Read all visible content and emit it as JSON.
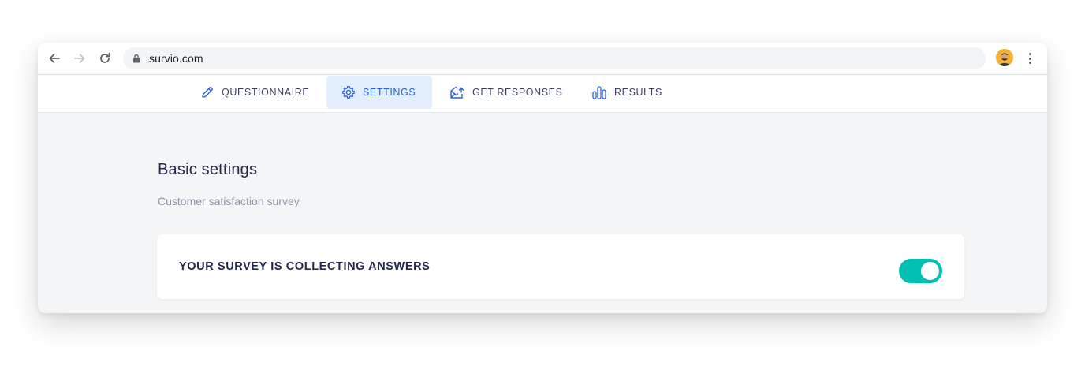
{
  "browser": {
    "url": "survio.com",
    "icons": {
      "back": "arrow-left-icon",
      "forward": "arrow-right-icon",
      "reload": "reload-icon",
      "lock": "lock-icon",
      "menu": "kebab-menu-icon"
    }
  },
  "tabs": [
    {
      "label": "QUESTIONNAIRE",
      "icon": "pencil-icon",
      "active": false
    },
    {
      "label": "SETTINGS",
      "icon": "gear-icon",
      "active": true
    },
    {
      "label": "GET RESPONSES",
      "icon": "envelope-share-icon",
      "active": false
    },
    {
      "label": "RESULTS",
      "icon": "bar-chart-icon",
      "active": false
    }
  ],
  "page": {
    "title": "Basic settings",
    "subtitle": "Customer satisfaction survey"
  },
  "collecting_card": {
    "label": "YOUR SURVEY IS COLLECTING ANSWERS",
    "toggle_on": true
  },
  "colors": {
    "accent": "#2a5fe0",
    "active_tab_bg": "#e3eefd",
    "toggle_on": "#00bfb3",
    "title": "#23284a",
    "subtitle": "#8f94a6",
    "page_bg": "#f4f5f7"
  }
}
